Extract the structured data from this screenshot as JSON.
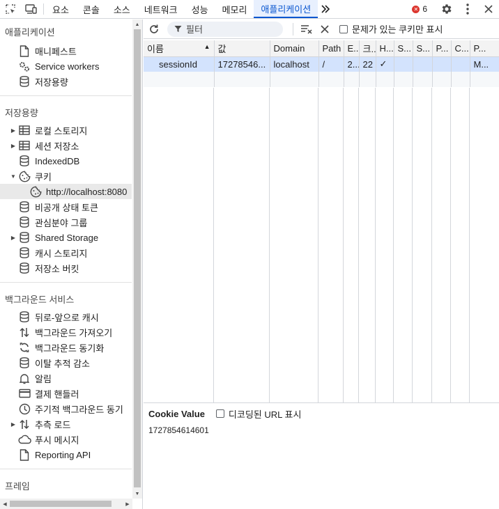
{
  "tabs": [
    "요소",
    "콘솔",
    "소스",
    "네트워크",
    "성능",
    "메모리",
    "애플리케이션"
  ],
  "active_tab_index": 6,
  "error_count": "6",
  "sidebar": {
    "application_header": "애플리케이션",
    "application_items": [
      {
        "label": "매니페스트",
        "icon": "document-icon"
      },
      {
        "label": "Service workers",
        "icon": "gears-icon"
      },
      {
        "label": "저장용량",
        "icon": "database-icon"
      }
    ],
    "storage_header": "저장용량",
    "storage_items": [
      {
        "label": "로컬 스토리지",
        "icon": "table-icon",
        "arrow": "right"
      },
      {
        "label": "세션 저장소",
        "icon": "table-icon",
        "arrow": "right"
      },
      {
        "label": "IndexedDB",
        "icon": "database-icon"
      },
      {
        "label": "쿠키",
        "icon": "cookie-icon",
        "arrow": "down"
      },
      {
        "label": "http://localhost:8080",
        "icon": "cookie-icon",
        "child": true,
        "selected": true
      },
      {
        "label": "비공개 상태 토큰",
        "icon": "database-icon"
      },
      {
        "label": "관심분야 그룹",
        "icon": "database-icon"
      },
      {
        "label": "Shared Storage",
        "icon": "database-icon",
        "arrow": "right"
      },
      {
        "label": "캐시 스토리지",
        "icon": "database-icon"
      },
      {
        "label": "저장소 버킷",
        "icon": "database-icon"
      }
    ],
    "background_header": "백그라운드 서비스",
    "background_items": [
      {
        "label": "뒤로-앞으로 캐시",
        "icon": "database-icon"
      },
      {
        "label": "백그라운드 가져오기",
        "icon": "fetch-arrows-icon"
      },
      {
        "label": "백그라운드 동기화",
        "icon": "sync-icon"
      },
      {
        "label": "이탈 추적 감소",
        "icon": "database-icon"
      },
      {
        "label": "알림",
        "icon": "bell-icon"
      },
      {
        "label": "결제 핸들러",
        "icon": "card-icon"
      },
      {
        "label": "주기적 백그라운드 동기",
        "icon": "clock-icon"
      },
      {
        "label": "추측 로드",
        "icon": "fetch-arrows-icon",
        "arrow": "right"
      },
      {
        "label": "푸시 메시지",
        "icon": "cloud-icon"
      },
      {
        "label": "Reporting API",
        "icon": "document-icon"
      }
    ],
    "frames_header": "프레임"
  },
  "toolbar": {
    "filter_placeholder": "필터",
    "only_issues_label": "문제가 있는 쿠키만 표시"
  },
  "table": {
    "columns": [
      "이름",
      "값",
      "Domain",
      "Path",
      "E...",
      "크...",
      "H...",
      "S...",
      "S...",
      "P...",
      "C...",
      "P..."
    ],
    "rows": [
      [
        "sessionId",
        "17278546...",
        "localhost",
        "/",
        "2...",
        "22",
        "✓",
        "",
        "",
        "",
        "",
        "M..."
      ]
    ]
  },
  "cookie_value": {
    "title": "Cookie Value",
    "decode_label": "디코딩된 URL 표시",
    "value": "1727854614601"
  },
  "colors": {
    "accent": "#0b57d0",
    "selected_row": "#d3e3fd",
    "error": "#dc362e"
  }
}
